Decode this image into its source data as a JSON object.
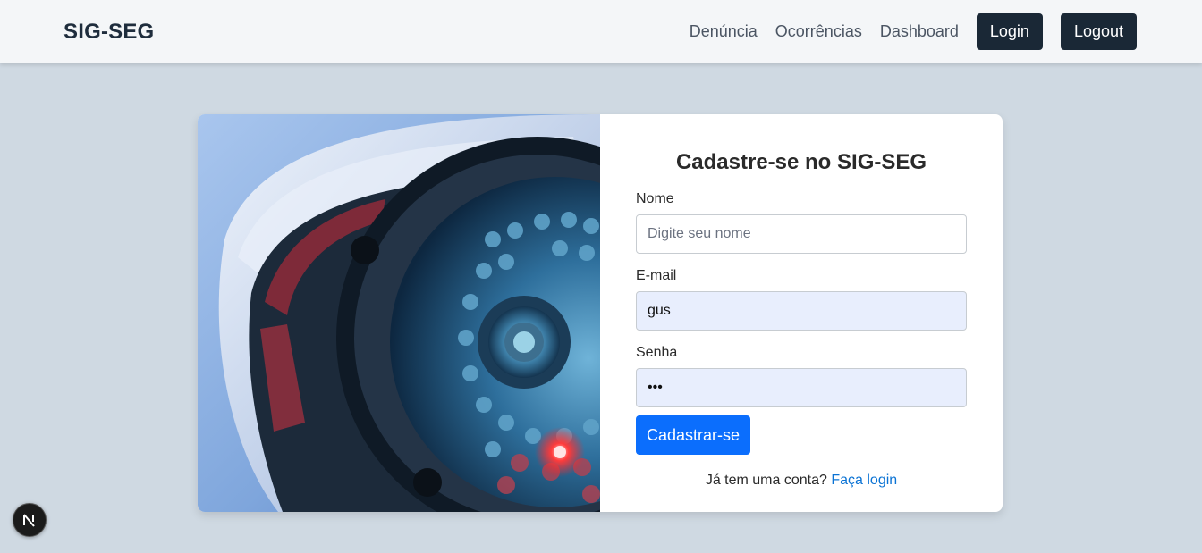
{
  "nav": {
    "brand": "SIG-SEG",
    "links": [
      "Denúncia",
      "Ocorrências",
      "Dashboard"
    ],
    "login_label": "Login",
    "logout_label": "Logout"
  },
  "form": {
    "title": "Cadastre-se no SIG-SEG",
    "name_label": "Nome",
    "name_placeholder": "Digite seu nome",
    "name_value": "",
    "email_label": "E-mail",
    "email_value": "gus",
    "password_label": "Senha",
    "password_value": "•••",
    "submit_label": "Cadastrar-se",
    "login_prompt": "Já tem uma conta?",
    "login_link": "Faça login"
  },
  "colors": {
    "nav_button": "#1a2836",
    "primary": "#0b6efd",
    "link": "#0b73d4",
    "background": "#cfd9e2"
  },
  "icons": {
    "dev_badge": "nextjs-logo-icon",
    "hero_image": "security-camera-image"
  }
}
